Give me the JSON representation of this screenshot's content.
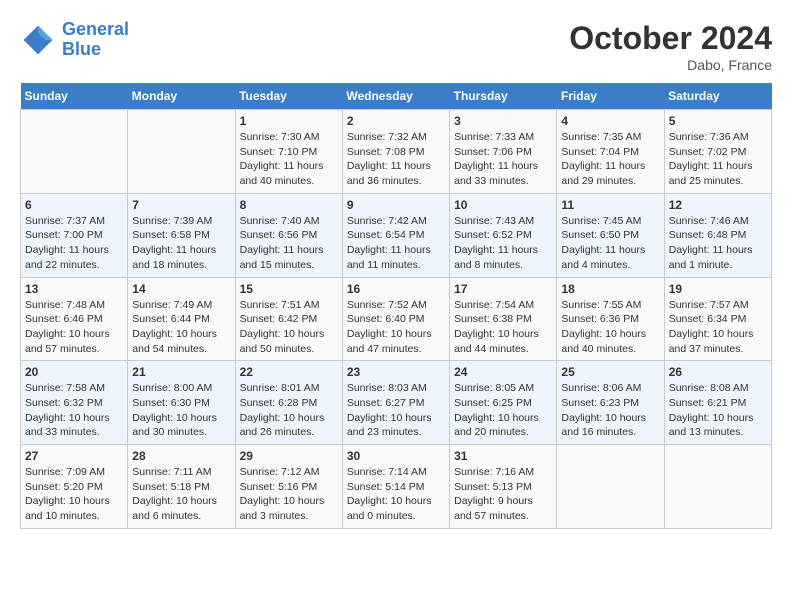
{
  "header": {
    "logo_line1": "General",
    "logo_line2": "Blue",
    "month": "October 2024",
    "location": "Dabo, France"
  },
  "weekdays": [
    "Sunday",
    "Monday",
    "Tuesday",
    "Wednesday",
    "Thursday",
    "Friday",
    "Saturday"
  ],
  "weeks": [
    [
      {
        "day": "",
        "info": ""
      },
      {
        "day": "",
        "info": ""
      },
      {
        "day": "1",
        "info": "Sunrise: 7:30 AM\nSunset: 7:10 PM\nDaylight: 11 hours and 40 minutes."
      },
      {
        "day": "2",
        "info": "Sunrise: 7:32 AM\nSunset: 7:08 PM\nDaylight: 11 hours and 36 minutes."
      },
      {
        "day": "3",
        "info": "Sunrise: 7:33 AM\nSunset: 7:06 PM\nDaylight: 11 hours and 33 minutes."
      },
      {
        "day": "4",
        "info": "Sunrise: 7:35 AM\nSunset: 7:04 PM\nDaylight: 11 hours and 29 minutes."
      },
      {
        "day": "5",
        "info": "Sunrise: 7:36 AM\nSunset: 7:02 PM\nDaylight: 11 hours and 25 minutes."
      }
    ],
    [
      {
        "day": "6",
        "info": "Sunrise: 7:37 AM\nSunset: 7:00 PM\nDaylight: 11 hours and 22 minutes."
      },
      {
        "day": "7",
        "info": "Sunrise: 7:39 AM\nSunset: 6:58 PM\nDaylight: 11 hours and 18 minutes."
      },
      {
        "day": "8",
        "info": "Sunrise: 7:40 AM\nSunset: 6:56 PM\nDaylight: 11 hours and 15 minutes."
      },
      {
        "day": "9",
        "info": "Sunrise: 7:42 AM\nSunset: 6:54 PM\nDaylight: 11 hours and 11 minutes."
      },
      {
        "day": "10",
        "info": "Sunrise: 7:43 AM\nSunset: 6:52 PM\nDaylight: 11 hours and 8 minutes."
      },
      {
        "day": "11",
        "info": "Sunrise: 7:45 AM\nSunset: 6:50 PM\nDaylight: 11 hours and 4 minutes."
      },
      {
        "day": "12",
        "info": "Sunrise: 7:46 AM\nSunset: 6:48 PM\nDaylight: 11 hours and 1 minute."
      }
    ],
    [
      {
        "day": "13",
        "info": "Sunrise: 7:48 AM\nSunset: 6:46 PM\nDaylight: 10 hours and 57 minutes."
      },
      {
        "day": "14",
        "info": "Sunrise: 7:49 AM\nSunset: 6:44 PM\nDaylight: 10 hours and 54 minutes."
      },
      {
        "day": "15",
        "info": "Sunrise: 7:51 AM\nSunset: 6:42 PM\nDaylight: 10 hours and 50 minutes."
      },
      {
        "day": "16",
        "info": "Sunrise: 7:52 AM\nSunset: 6:40 PM\nDaylight: 10 hours and 47 minutes."
      },
      {
        "day": "17",
        "info": "Sunrise: 7:54 AM\nSunset: 6:38 PM\nDaylight: 10 hours and 44 minutes."
      },
      {
        "day": "18",
        "info": "Sunrise: 7:55 AM\nSunset: 6:36 PM\nDaylight: 10 hours and 40 minutes."
      },
      {
        "day": "19",
        "info": "Sunrise: 7:57 AM\nSunset: 6:34 PM\nDaylight: 10 hours and 37 minutes."
      }
    ],
    [
      {
        "day": "20",
        "info": "Sunrise: 7:58 AM\nSunset: 6:32 PM\nDaylight: 10 hours and 33 minutes."
      },
      {
        "day": "21",
        "info": "Sunrise: 8:00 AM\nSunset: 6:30 PM\nDaylight: 10 hours and 30 minutes."
      },
      {
        "day": "22",
        "info": "Sunrise: 8:01 AM\nSunset: 6:28 PM\nDaylight: 10 hours and 26 minutes."
      },
      {
        "day": "23",
        "info": "Sunrise: 8:03 AM\nSunset: 6:27 PM\nDaylight: 10 hours and 23 minutes."
      },
      {
        "day": "24",
        "info": "Sunrise: 8:05 AM\nSunset: 6:25 PM\nDaylight: 10 hours and 20 minutes."
      },
      {
        "day": "25",
        "info": "Sunrise: 8:06 AM\nSunset: 6:23 PM\nDaylight: 10 hours and 16 minutes."
      },
      {
        "day": "26",
        "info": "Sunrise: 8:08 AM\nSunset: 6:21 PM\nDaylight: 10 hours and 13 minutes."
      }
    ],
    [
      {
        "day": "27",
        "info": "Sunrise: 7:09 AM\nSunset: 5:20 PM\nDaylight: 10 hours and 10 minutes."
      },
      {
        "day": "28",
        "info": "Sunrise: 7:11 AM\nSunset: 5:18 PM\nDaylight: 10 hours and 6 minutes."
      },
      {
        "day": "29",
        "info": "Sunrise: 7:12 AM\nSunset: 5:16 PM\nDaylight: 10 hours and 3 minutes."
      },
      {
        "day": "30",
        "info": "Sunrise: 7:14 AM\nSunset: 5:14 PM\nDaylight: 10 hours and 0 minutes."
      },
      {
        "day": "31",
        "info": "Sunrise: 7:16 AM\nSunset: 5:13 PM\nDaylight: 9 hours and 57 minutes."
      },
      {
        "day": "",
        "info": ""
      },
      {
        "day": "",
        "info": ""
      }
    ]
  ]
}
